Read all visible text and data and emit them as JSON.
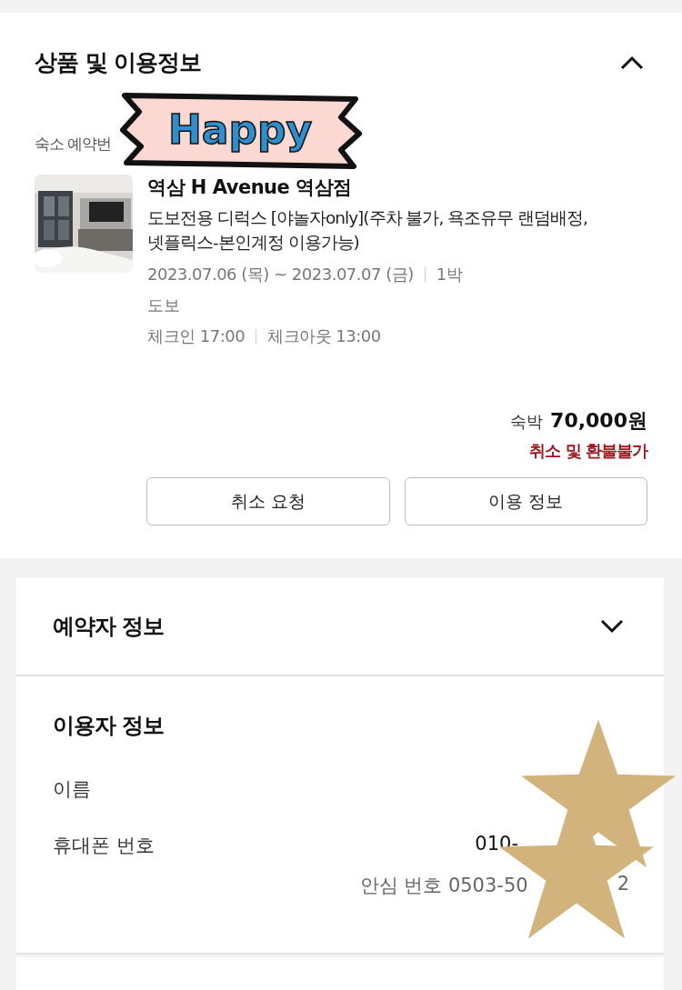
{
  "product_section": {
    "title": "상품 및 이용정보",
    "expanded": true,
    "booking_number_label": "숙소 예약번",
    "item": {
      "name": "역삼 H Avenue 역삼점",
      "room": "도보전용 디럭스 [야놀자only](주차 불가, 욕조유무 랜덤배정, 넷플릭스-본인계정 이용가능)",
      "dates": "2023.07.06 (목) ~ 2023.07.07 (금)",
      "nights": "1박",
      "access": "도보",
      "checkin": "체크인 17:00",
      "checkout": "체크아웃 13:00"
    },
    "price_label": "숙박",
    "price": "70,000원",
    "refund_note": "취소 및 환불불가",
    "buttons": [
      "취소 요청",
      "이용 정보"
    ]
  },
  "booker_section": {
    "title": "예약자 정보",
    "expanded": false
  },
  "user_section": {
    "title": "이용자 정보",
    "rows": [
      {
        "label": "이름"
      },
      {
        "label": "휴대폰 번호",
        "value": "010-"
      }
    ],
    "safe_number": "안심 번호 0503-50",
    "safe_number_tail": "2"
  },
  "stickers": [
    {
      "kind": "banner",
      "text": "Happy"
    },
    {
      "kind": "star"
    },
    {
      "kind": "star"
    }
  ]
}
